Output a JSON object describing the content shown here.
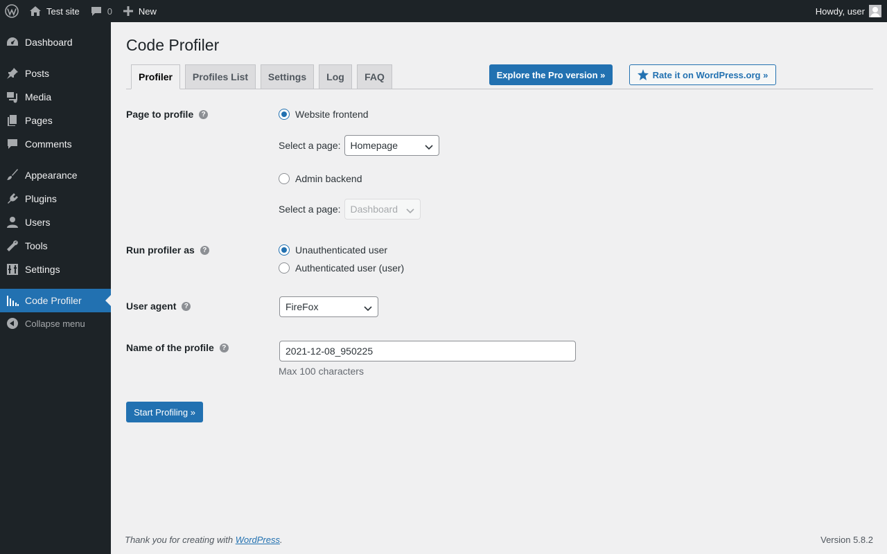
{
  "adminbar": {
    "site_name": "Test site",
    "comments_count": "0",
    "new_label": "New",
    "howdy": "Howdy, user"
  },
  "sidebar": {
    "items": [
      {
        "label": "Dashboard",
        "icon": "dashboard-icon"
      },
      {
        "label": "Posts",
        "icon": "pin-icon"
      },
      {
        "label": "Media",
        "icon": "media-icon"
      },
      {
        "label": "Pages",
        "icon": "pages-icon"
      },
      {
        "label": "Comments",
        "icon": "comment-icon"
      },
      {
        "label": "Appearance",
        "icon": "brush-icon"
      },
      {
        "label": "Plugins",
        "icon": "plugin-icon"
      },
      {
        "label": "Users",
        "icon": "user-icon"
      },
      {
        "label": "Tools",
        "icon": "wrench-icon"
      },
      {
        "label": "Settings",
        "icon": "settings-icon"
      },
      {
        "label": "Code Profiler",
        "icon": "chart-icon",
        "current": true
      }
    ],
    "collapse_label": "Collapse menu"
  },
  "page": {
    "title": "Code Profiler",
    "tabs": [
      "Profiler",
      "Profiles List",
      "Settings",
      "Log",
      "FAQ"
    ],
    "active_tab": "Profiler",
    "pro_button": "Explore the Pro version »",
    "rate_button": "Rate it on WordPress.org »"
  },
  "form": {
    "page_to_profile": {
      "label": "Page to profile",
      "frontend_label": "Website frontend",
      "frontend_checked": true,
      "frontend_select_label": "Select a page:",
      "frontend_select_value": "Homepage",
      "backend_label": "Admin backend",
      "backend_checked": false,
      "backend_select_label": "Select a page:",
      "backend_select_value": "Dashboard"
    },
    "run_as": {
      "label": "Run profiler as",
      "option1": "Unauthenticated user",
      "option1_checked": true,
      "option2": "Authenticated user (user)",
      "option2_checked": false
    },
    "user_agent": {
      "label": "User agent",
      "value": "FireFox"
    },
    "profile_name": {
      "label": "Name of the profile",
      "value": "2021-12-08_950225",
      "hint": "Max 100 characters"
    },
    "help_glyph": "?",
    "start_button": "Start Profiling »"
  },
  "footer": {
    "thanks_prefix": "Thank you for creating with ",
    "thanks_link": "WordPress",
    "thanks_suffix": ".",
    "version": "Version 5.8.2"
  },
  "colors": {
    "accent": "#2271b1",
    "sidebar_bg": "#1d2327",
    "content_bg": "#f0f0f1"
  }
}
